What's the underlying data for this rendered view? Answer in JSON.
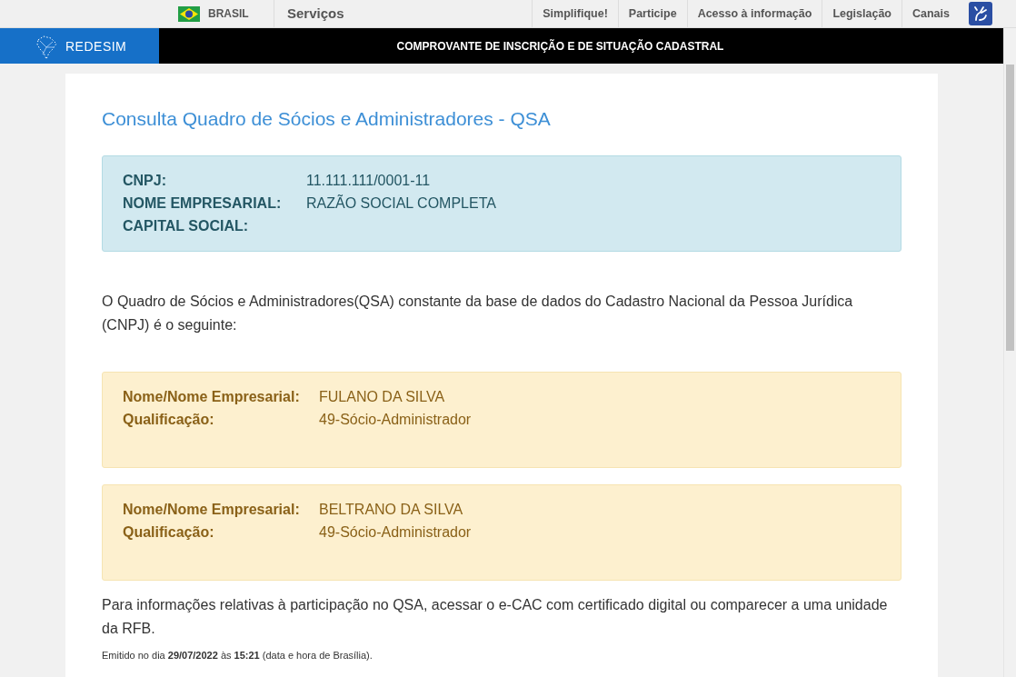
{
  "gov_bar": {
    "country": "BRASIL",
    "services": "Serviços",
    "links": [
      "Simplifique!",
      "Participe",
      "Acesso à informação",
      "Legislação",
      "Canais"
    ]
  },
  "header": {
    "logo_text": "REDESIM",
    "title": "COMPROVANTE DE INSCRIÇÃO E DE SITUAÇÃO CADASTRAL"
  },
  "page_title": "Consulta Quadro de Sócios e Administradores - QSA",
  "company": [
    {
      "label": "CNPJ:",
      "value": "11.111.111/0001-11"
    },
    {
      "label": "NOME EMPRESARIAL:",
      "value": "RAZÃO SOCIAL COMPLETA"
    },
    {
      "label": "CAPITAL SOCIAL:"
    }
  ],
  "intro": "O Quadro de Sócios e Administradores(QSA) constante da base de dados do Cadastro Nacional da Pessoa Jurídica (CNPJ) é o seguinte:",
  "partners": [
    [
      {
        "label": "Nome/Nome Empresarial:",
        "value": "FULANO DA SILVA"
      },
      {
        "label": "Qualificação:",
        "value": "49-Sócio-Administrador"
      }
    ],
    [
      {
        "label": "Nome/Nome Empresarial:",
        "value": "BELTRANO DA SILVA"
      },
      {
        "label": "Qualificação:",
        "value": "49-Sócio-Administrador"
      }
    ]
  ],
  "note": "Para informações relativas à participação no QSA, acessar o e-CAC com certificado digital ou comparecer a uma unidade da RFB.",
  "issued": "Emitido no dia **29/07/2022** às **15:21** (data e hora de Brasília)."
}
